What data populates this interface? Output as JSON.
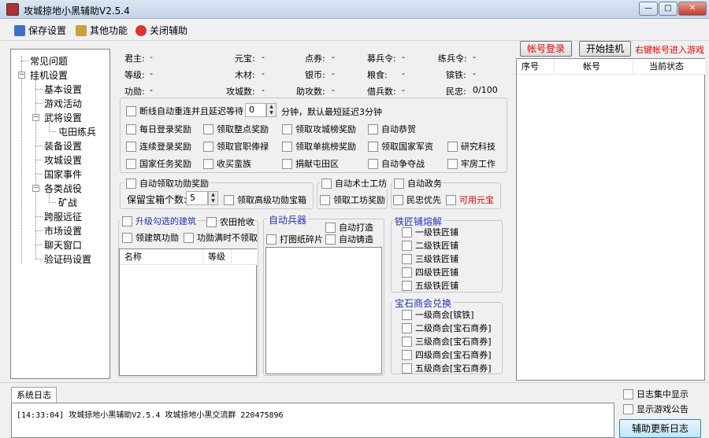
{
  "window": {
    "title": "攻城掠地小黑辅助V2.5.4",
    "min": "—",
    "max": "□",
    "close": "✕"
  },
  "menu": {
    "save": "保存设置",
    "other": "其他功能",
    "close": "关闭辅助"
  },
  "tree": {
    "items": [
      "常见问题",
      "挂机设置",
      "基本设置",
      "游戏活动",
      "武将设置",
      "屯田练兵",
      "装备设置",
      "攻城设置",
      "国家事件",
      "各类战役",
      "矿战",
      "跨服远征",
      "市场设置",
      "聊天窗口",
      "验证码设置"
    ]
  },
  "stats": {
    "r1": [
      "君主:",
      "-",
      "元宝:",
      "-",
      "点券:",
      "-",
      "募兵令:",
      "-",
      "练兵令:",
      "-"
    ],
    "r2": [
      "等级:",
      "-",
      "木材:",
      "-",
      "银币:",
      "-",
      "粮食:",
      "-",
      "镔铁:",
      "-"
    ],
    "r3": [
      "功勋:",
      "-",
      "攻城数:",
      "-",
      "助攻数:",
      "-",
      "借兵数:",
      "-",
      "民忠:",
      "0/100"
    ]
  },
  "options": {
    "reconnect": "断线自动重连并且延迟等待",
    "reconnect_value": "0",
    "reconnect_suffix": "分钟，默认最短延迟3分钟",
    "row1": [
      "每日登录奖励",
      "领取整点奖励",
      "领取攻城榜奖励",
      "自动恭贺"
    ],
    "row2": [
      "连续登录奖励",
      "领取官职俸禄",
      "领取单挑榜奖励",
      "领取国家军资",
      "研究科技"
    ],
    "row3": [
      "国家任务奖励",
      "收买蛮族",
      "捐献屯田区",
      "自动争夺战",
      "牢房工作"
    ]
  },
  "merit": {
    "title": "自动领取功勋奖励",
    "keep_label": "保留宝箱个数:",
    "keep_value": "5",
    "high": "领取高级功勋宝箱"
  },
  "workshop": {
    "auto": "自动术士工坊",
    "reward": "领取工坊奖励"
  },
  "politics": {
    "title": "自动政务",
    "loyal": "民忠优先",
    "gold": "可用元宝"
  },
  "building": {
    "title": "升级勾选的建筑",
    "farm": "农田抢收",
    "merit": "领建筑功勋",
    "full": "功勋满时不领取",
    "col_name": "名称",
    "col_level": "等级"
  },
  "weapon": {
    "title": "自动兵器",
    "make": "自动打造",
    "fragment": "打图纸碎片",
    "cast": "自动铸造"
  },
  "smith": {
    "title": "铁匠铺熔解",
    "items": [
      "一级铁匠铺",
      "二级铁匠铺",
      "三级铁匠铺",
      "四级铁匠铺",
      "五级铁匠铺"
    ]
  },
  "gem": {
    "title": "宝石商会兑换",
    "items": [
      "一级商会[镔铁]",
      "二级商会[宝石商券]",
      "三级商会[宝石商券]",
      "四级商会[宝石商券]",
      "五级商会[宝石商券]"
    ]
  },
  "account": {
    "login": "帐号登录",
    "start": "开始挂机",
    "hint": "右键帐号进入游戏",
    "col_no": "序号",
    "col_acc": "帐号",
    "col_status": "当前状态"
  },
  "log": {
    "tab": "系统日志",
    "line": "[14:33:04] 攻城掠地小黑辅助V2.5.4  攻城掠地小黑交流群 220475896",
    "centralized": "日志集中显示",
    "notice": "显示游戏公告",
    "update": "辅助更新日志"
  },
  "colors": {
    "accent_red": "#ff0000",
    "accent_blue": "#2233bb"
  }
}
